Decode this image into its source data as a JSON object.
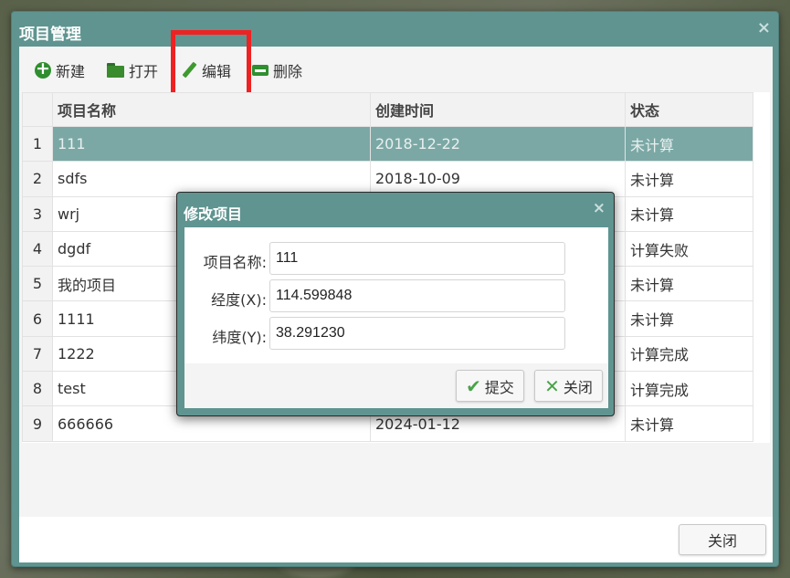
{
  "window": {
    "title": "项目管理",
    "close_glyph": "×",
    "footer_close_label": "关闭"
  },
  "toolbar": {
    "new_label": "新建",
    "open_label": "打开",
    "edit_label": "编辑",
    "delete_label": "删除"
  },
  "grid": {
    "columns": [
      "项目名称",
      "创建时间",
      "状态"
    ],
    "rows": [
      {
        "num": "1",
        "name": "111",
        "created": "2018-12-22",
        "status": "未计算"
      },
      {
        "num": "2",
        "name": "sdfs",
        "created": "2018-10-09",
        "status": "未计算"
      },
      {
        "num": "3",
        "name": "wrj",
        "created": "",
        "status": "未计算"
      },
      {
        "num": "4",
        "name": "dgdf",
        "created": "",
        "status": "计算失败"
      },
      {
        "num": "5",
        "name": "我的项目",
        "created": "",
        "status": "未计算"
      },
      {
        "num": "6",
        "name": "1111",
        "created": "",
        "status": "未计算"
      },
      {
        "num": "7",
        "name": "1222",
        "created": "",
        "status": "计算完成"
      },
      {
        "num": "8",
        "name": "test",
        "created": "",
        "status": "计算完成"
      },
      {
        "num": "9",
        "name": "666666",
        "created": "2024-01-12",
        "status": "未计算"
      }
    ]
  },
  "dialog": {
    "title": "修改项目",
    "close_glyph": "×",
    "fields": [
      {
        "label": "项目名称:",
        "value": "111"
      },
      {
        "label": "经度(X):",
        "value": "114.599848"
      },
      {
        "label": "纬度(Y):",
        "value": "38.291230"
      }
    ],
    "submit_label": "提交",
    "close_label": "关闭"
  },
  "colors": {
    "title_bar": "#5f9490",
    "selected_row": "#7ba8a5",
    "highlight": "#ee2222",
    "icon_green": "#2f8f2f"
  },
  "icons": {
    "new": "plus-circle-icon",
    "open": "folder-icon",
    "edit": "pencil-icon",
    "delete": "minus-box-icon",
    "submit": "check-icon",
    "close": "x-icon"
  }
}
